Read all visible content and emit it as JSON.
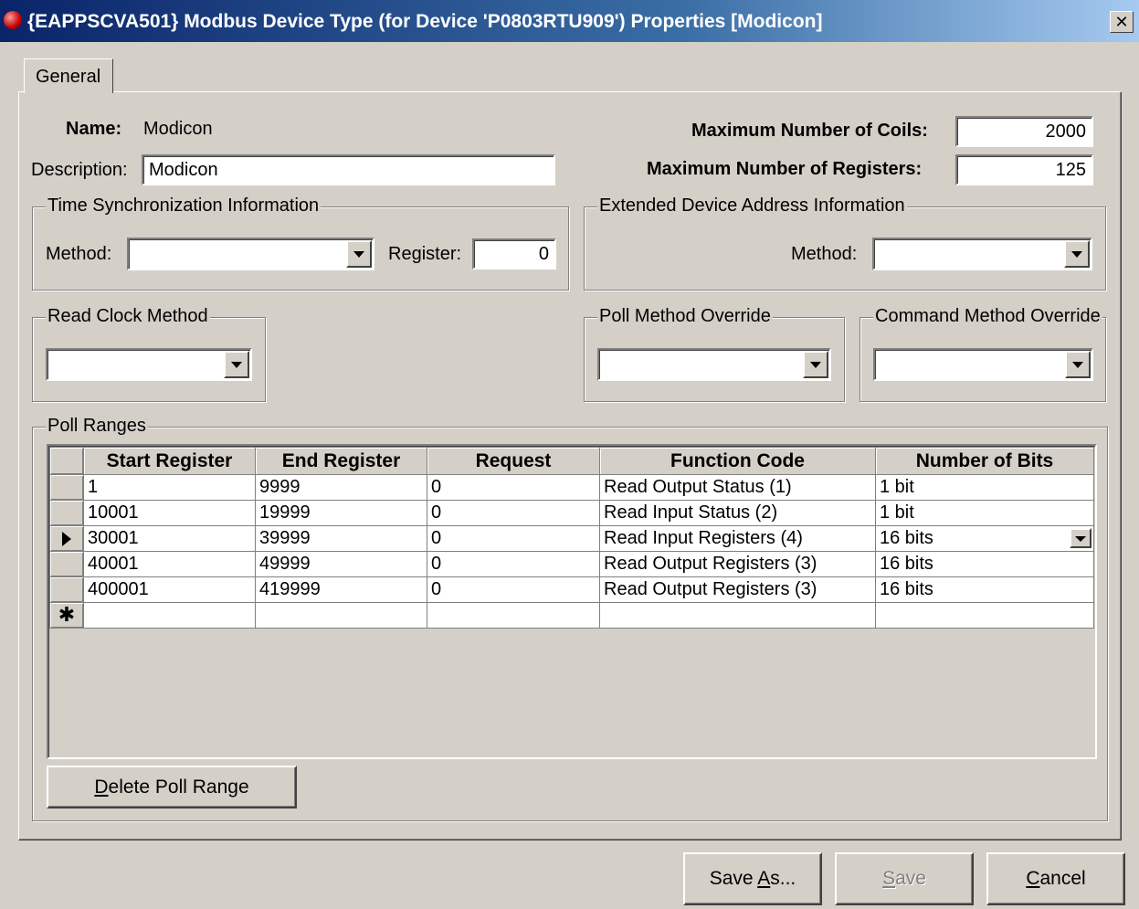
{
  "window": {
    "title": "{EAPPSCVA501} Modbus Device Type (for Device 'P0803RTU909') Properties [Modicon]",
    "close_glyph": "✕"
  },
  "tabs": [
    {
      "label": "General",
      "active": true
    }
  ],
  "general": {
    "name_label": "Name:",
    "name_value": "Modicon",
    "description_label": "Description:",
    "description_value": "Modicon",
    "max_coils_label": "Maximum Number of Coils:",
    "max_coils_value": "2000",
    "max_registers_label": "Maximum Number of Registers:",
    "max_registers_value": "125"
  },
  "time_sync": {
    "title": "Time Synchronization Information",
    "method_label": "Method:",
    "method_value": "",
    "register_label": "Register:",
    "register_value": "0"
  },
  "extended_address": {
    "title": "Extended Device Address Information",
    "method_label": "Method:",
    "method_value": ""
  },
  "read_clock": {
    "title": "Read Clock Method",
    "value": ""
  },
  "poll_override": {
    "title": "Poll Method Override",
    "value": ""
  },
  "command_override": {
    "title": "Command Method Override",
    "value": ""
  },
  "poll_ranges": {
    "title": "Poll Ranges",
    "columns": [
      "Start Register",
      "End Register",
      "Request",
      "Function Code",
      "Number of Bits"
    ],
    "rows": [
      {
        "start": "1",
        "end": "9999",
        "request": "0",
        "function": "Read Output Status (1)",
        "bits": "1 bit"
      },
      {
        "start": "10001",
        "end": "19999",
        "request": "0",
        "function": "Read Input Status (2)",
        "bits": "1 bit"
      },
      {
        "start": "30001",
        "end": "39999",
        "request": "0",
        "function": "Read Input Registers (4)",
        "bits": "16 bits"
      },
      {
        "start": "40001",
        "end": "49999",
        "request": "0",
        "function": "Read Output Registers (3)",
        "bits": "16 bits"
      },
      {
        "start": "400001",
        "end": "419999",
        "request": "0",
        "function": "Read Output Registers (3)",
        "bits": "16 bits"
      }
    ],
    "current_row_marker": "▶",
    "new_row_marker": "✱",
    "delete_button": {
      "mnemonic": "D",
      "rest": "elete Poll Range"
    }
  },
  "footer": {
    "save_as": {
      "pre": "Save ",
      "mnemonic": "A",
      "post": "s..."
    },
    "save": {
      "mnemonic": "S",
      "post": "ave",
      "enabled": false
    },
    "cancel": {
      "mnemonic": "C",
      "post": "ancel"
    }
  },
  "colors": {
    "face": "#d4d0c8",
    "title_start": "#0a246a",
    "title_end": "#a6caf0"
  }
}
